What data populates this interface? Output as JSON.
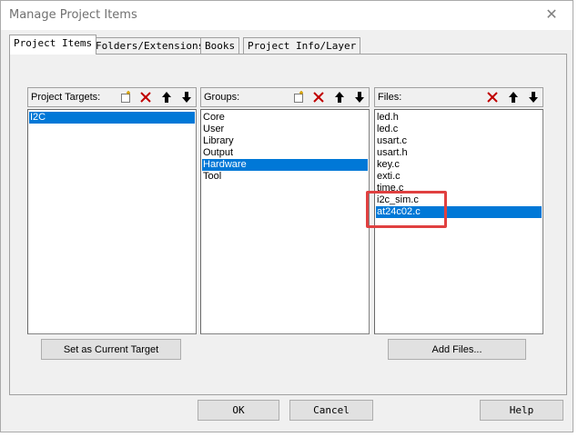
{
  "window": {
    "title": "Manage Project Items",
    "close_glyph": "✕"
  },
  "tabs": [
    {
      "label": "Project Items",
      "active": true
    },
    {
      "label": "Folders/Extensions",
      "active": false
    },
    {
      "label": "Books",
      "active": false
    },
    {
      "label": "Project Info/Layer",
      "active": false
    }
  ],
  "targets_panel": {
    "label": "Project Targets:",
    "items": [
      "I2C"
    ],
    "selected_index": 0,
    "button_label": "Set as Current Target"
  },
  "groups_panel": {
    "label": "Groups:",
    "items": [
      "Core",
      "User",
      "Library",
      "Output",
      "Hardware",
      "Tool"
    ],
    "selected_index": 4
  },
  "files_panel": {
    "label": "Files:",
    "items": [
      "led.h",
      "led.c",
      "usart.c",
      "usart.h",
      "key.c",
      "exti.c",
      "time.c",
      "i2c_sim.c",
      "at24c02.c"
    ],
    "selected_index": 8,
    "button_label": "Add Files..."
  },
  "footer": {
    "ok_label": "OK",
    "cancel_label": "Cancel",
    "help_label": "Help"
  },
  "colors": {
    "selection": "#0078d7",
    "delete_icon": "#c00000",
    "annotation_box": "#e04040"
  }
}
